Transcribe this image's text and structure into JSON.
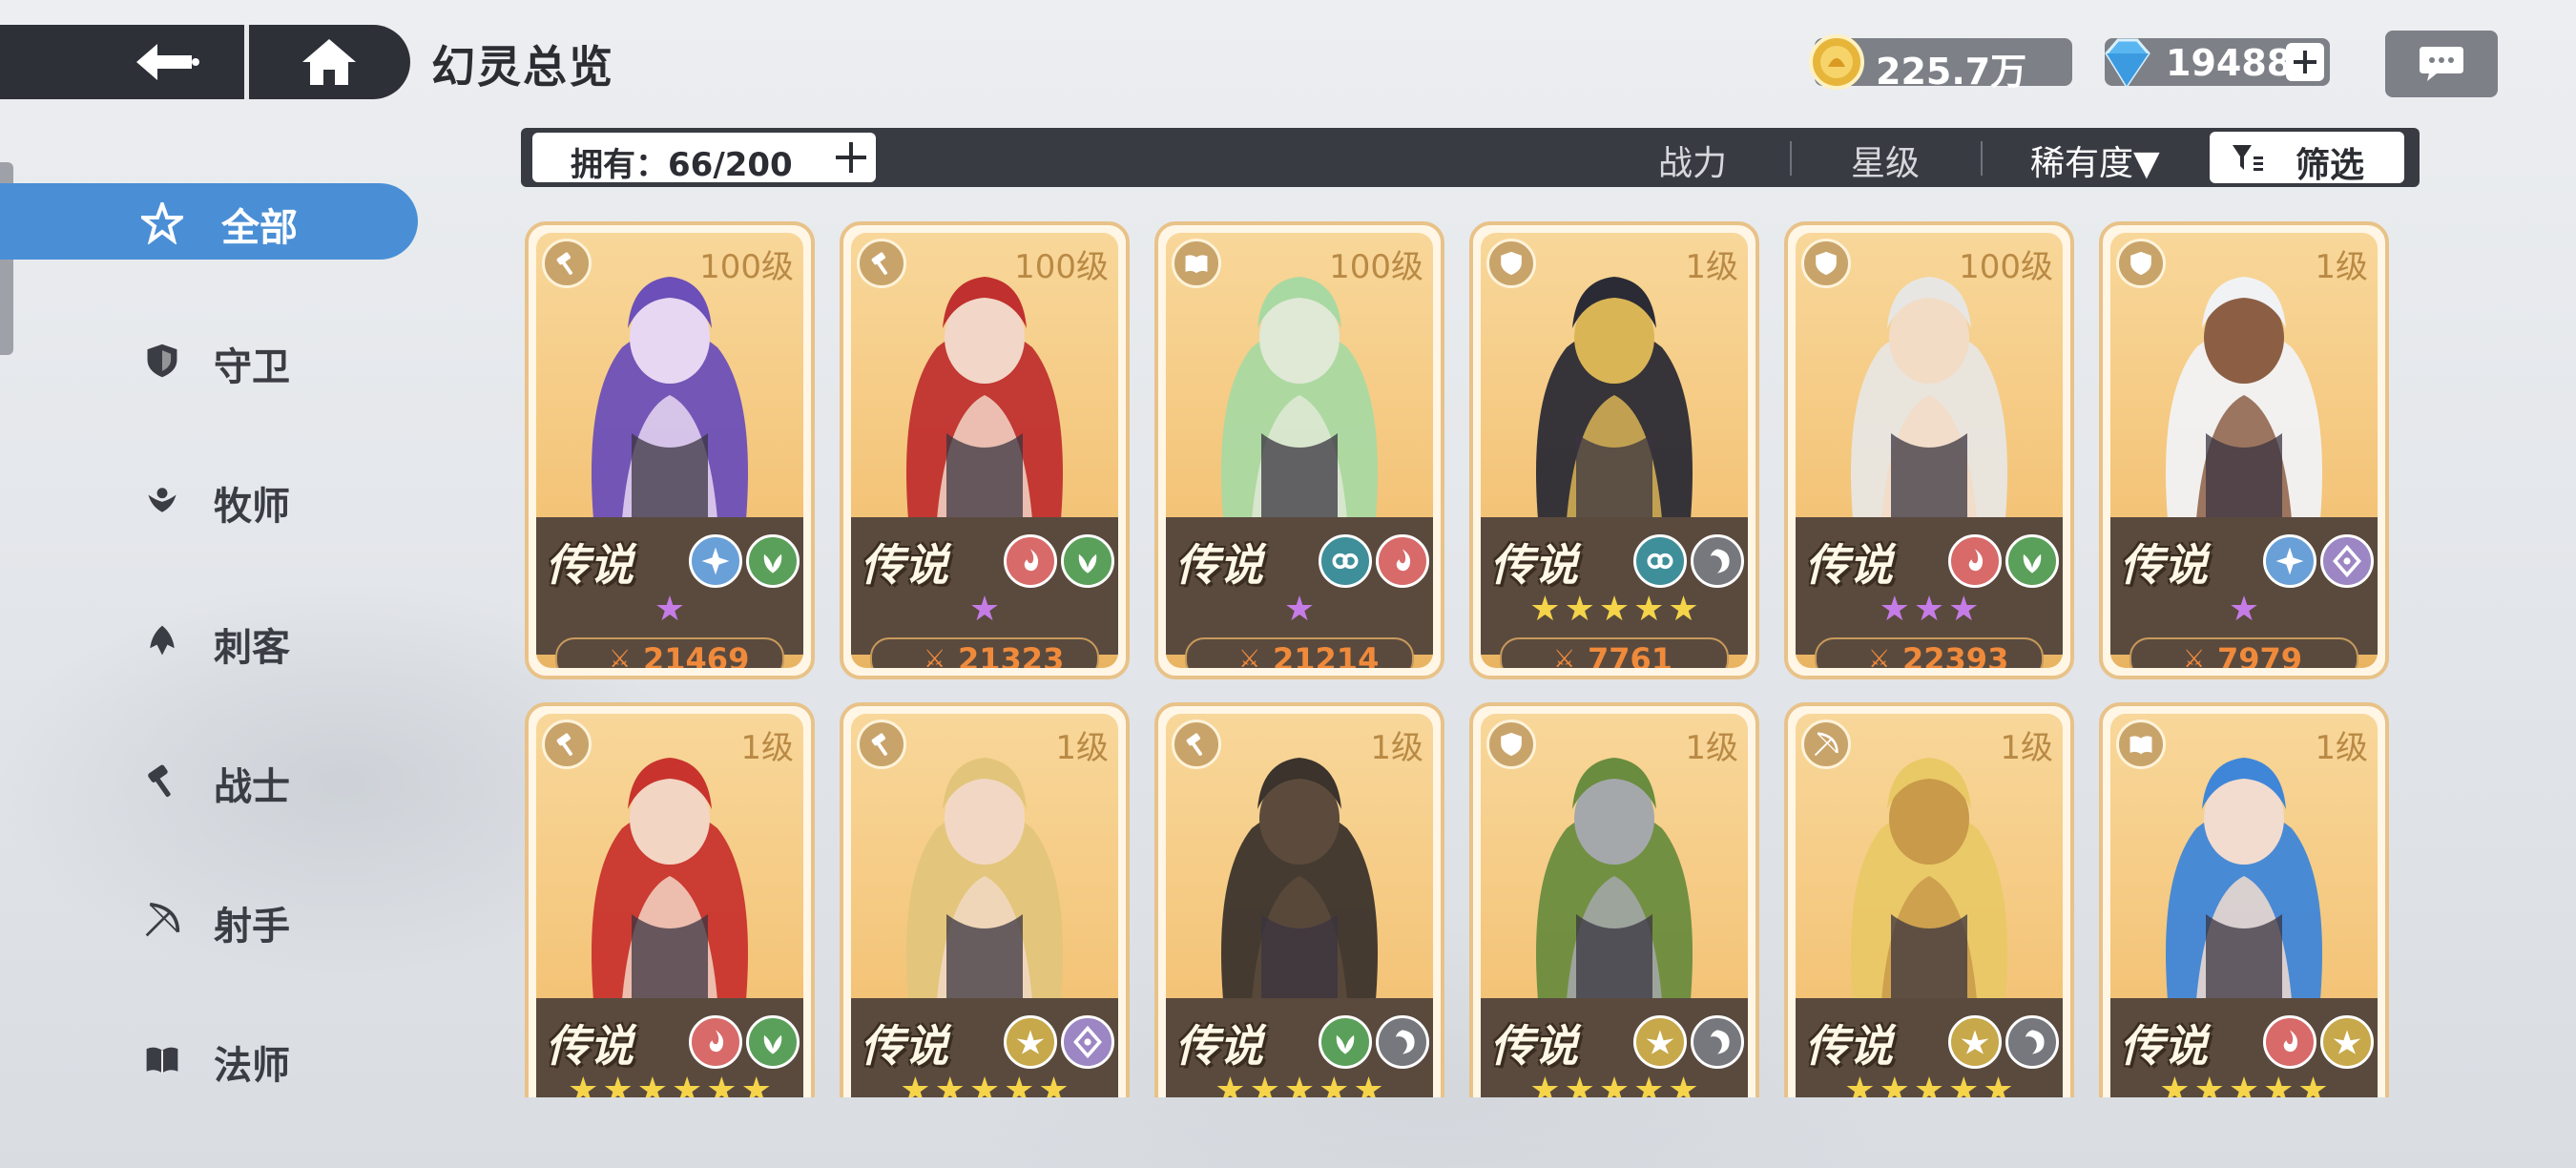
{
  "header": {
    "title": "幻灵总览",
    "gold": "225.7万",
    "gems": "19488"
  },
  "filter_bar": {
    "owned": "拥有：66/200",
    "sort_power": "战力",
    "sort_star": "星级",
    "sort_rarity": "稀有度▼",
    "filter": "筛选"
  },
  "sidebar": {
    "items": [
      {
        "label": "全部",
        "icon": "all-star-icon",
        "active": true
      },
      {
        "label": "守卫",
        "icon": "shield-icon",
        "active": false
      },
      {
        "label": "牧师",
        "icon": "priest-icon",
        "active": false
      },
      {
        "label": "刺客",
        "icon": "assassin-icon",
        "active": false
      },
      {
        "label": "战士",
        "icon": "hammer-icon",
        "active": false
      },
      {
        "label": "射手",
        "icon": "bow-icon",
        "active": false
      },
      {
        "label": "法师",
        "icon": "book-icon",
        "active": false
      }
    ]
  },
  "colors": {
    "accent": "#4a8fd6",
    "dark_bar": "#393b43",
    "power": "#f08a3b",
    "star_gold": "#f5d44a",
    "star_purple": "#c67ce6"
  },
  "cards": [
    {
      "level": "100级",
      "rarity": "传说",
      "class": "hammer-icon",
      "elements": [
        "ice",
        "nature"
      ],
      "stars": 1,
      "star_color": "purple",
      "power": "21469",
      "hair": "#6c4fb8",
      "skin": "#e8d7f2"
    },
    {
      "level": "100级",
      "rarity": "传说",
      "class": "hammer-icon",
      "elements": [
        "fire",
        "nature"
      ],
      "stars": 1,
      "star_color": "purple",
      "power": "21323",
      "hair": "#c0302e",
      "skin": "#f2d6c8"
    },
    {
      "level": "100级",
      "rarity": "传说",
      "class": "book-icon",
      "elements": [
        "water",
        "fire"
      ],
      "stars": 1,
      "star_color": "purple",
      "power": "21214",
      "hair": "#a9d9a2",
      "skin": "#dfe9d6"
    },
    {
      "level": "1级",
      "rarity": "传说",
      "class": "shield-icon",
      "elements": [
        "water",
        "dark"
      ],
      "stars": 5,
      "star_color": "gold",
      "power": "7761",
      "hair": "#2b2b35",
      "skin": "#d9b556"
    },
    {
      "level": "100级",
      "rarity": "传说",
      "class": "shield-icon",
      "elements": [
        "fire",
        "nature"
      ],
      "stars": 3,
      "star_color": "purple",
      "power": "22393",
      "hair": "#e8e6e2",
      "skin": "#f2dcc6"
    },
    {
      "level": "1级",
      "rarity": "传说",
      "class": "shield-icon",
      "elements": [
        "ice",
        "arcane"
      ],
      "stars": 1,
      "star_color": "purple",
      "power": "7979",
      "hair": "#f1f2f4",
      "skin": "#8c5f45"
    },
    {
      "level": "1级",
      "rarity": "传说",
      "class": "hammer-icon",
      "elements": [
        "fire",
        "nature"
      ],
      "stars": 6,
      "star_color": "gold",
      "power": "",
      "hair": "#c8342d",
      "skin": "#f3d5c4"
    },
    {
      "level": "1级",
      "rarity": "传说",
      "class": "hammer-icon",
      "elements": [
        "light",
        "arcane"
      ],
      "stars": 5,
      "star_color": "gold",
      "power": "",
      "hair": "#e2c57b",
      "skin": "#f2d8c4"
    },
    {
      "level": "1级",
      "rarity": "传说",
      "class": "hammer-icon",
      "elements": [
        "nature",
        "dark"
      ],
      "stars": 5,
      "star_color": "gold",
      "power": "",
      "hair": "#3b332c",
      "skin": "#5c4b3c"
    },
    {
      "level": "1级",
      "rarity": "传说",
      "class": "shield-icon",
      "elements": [
        "light",
        "dark"
      ],
      "stars": 5,
      "star_color": "gold",
      "power": "",
      "hair": "#6a8c3e",
      "skin": "#a4a8ab"
    },
    {
      "level": "1级",
      "rarity": "传说",
      "class": "bow-icon",
      "elements": [
        "light",
        "dark"
      ],
      "stars": 5,
      "star_color": "gold",
      "power": "",
      "hair": "#e9c866",
      "skin": "#c89a4a"
    },
    {
      "level": "1级",
      "rarity": "传说",
      "class": "book-icon",
      "elements": [
        "fire",
        "light"
      ],
      "stars": 5,
      "star_color": "gold",
      "power": "",
      "hair": "#3f86d8",
      "skin": "#f2dccf"
    }
  ]
}
